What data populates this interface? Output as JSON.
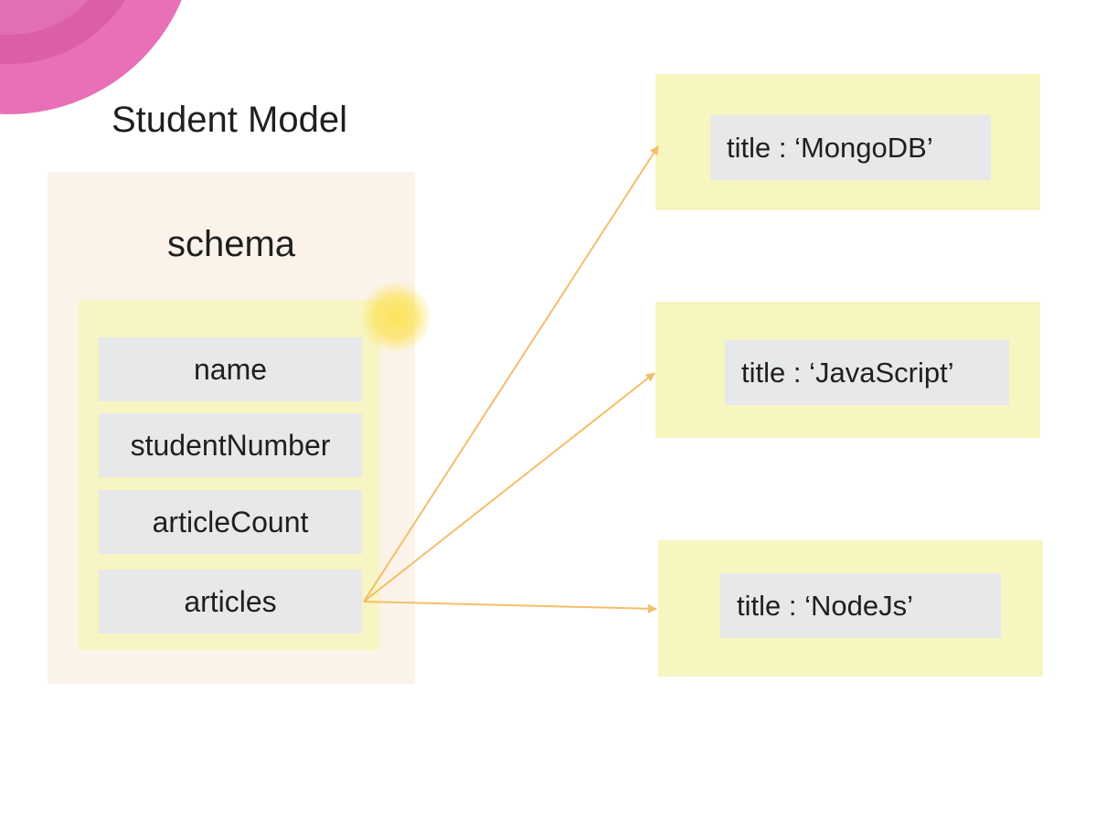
{
  "title": "Student Model",
  "schema": {
    "label": "schema",
    "fields": [
      "name",
      "studentNumber",
      "articleCount",
      "articles"
    ]
  },
  "documents": [
    "title : ‘MongoDB’",
    "title : ‘JavaScript’",
    "title : ‘NodeJs’"
  ],
  "colors": {
    "schema_panel": "#fbf3ea",
    "fields_panel": "#f8f5c4",
    "field_box": "#e6e8ea",
    "doc_card": "#f8f6c0",
    "arrow": "#f3be6a",
    "decor_pink": "#e96fb6"
  }
}
